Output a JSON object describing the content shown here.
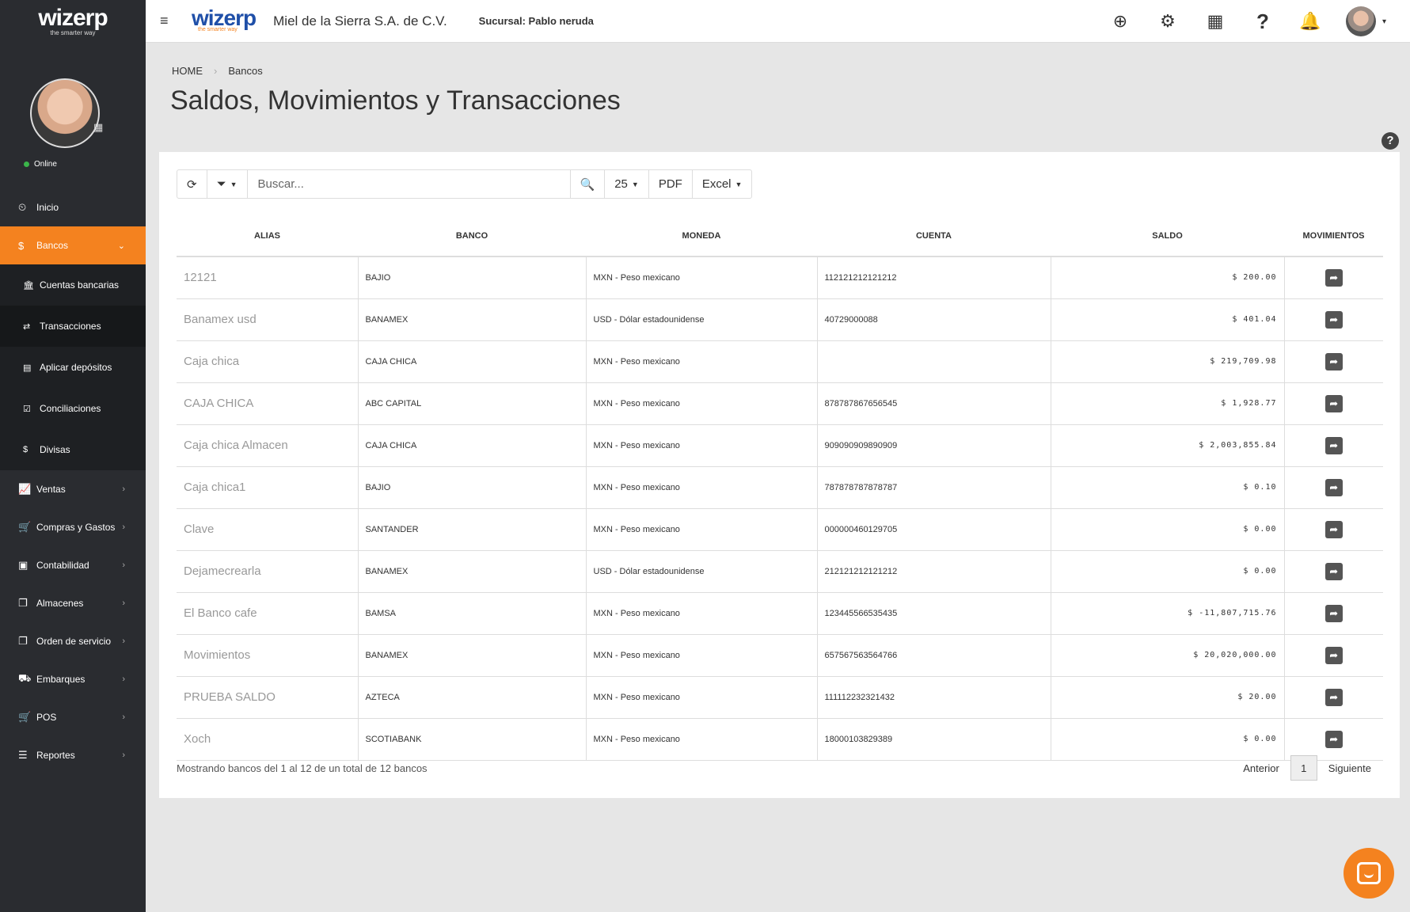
{
  "sidebar": {
    "brand": "wizerp",
    "tagline": "the smarter way",
    "calendar_icon": "calendar-icon",
    "status": "Online",
    "items": [
      {
        "icon": "dashboard-icon",
        "glyph": "⏲",
        "label": "Inicio"
      },
      {
        "icon": "dollar-icon",
        "glyph": "$",
        "label": "Bancos"
      }
    ],
    "submenu": [
      {
        "icon": "bank-icon",
        "glyph": "🏛",
        "label": "Cuentas bancarias"
      },
      {
        "icon": "exchange-icon",
        "glyph": "⇄",
        "label": "Transacciones"
      },
      {
        "icon": "file-icon",
        "glyph": "▤",
        "label": "Aplicar depósitos"
      },
      {
        "icon": "check-square-icon",
        "glyph": "☑",
        "label": "Conciliaciones"
      },
      {
        "icon": "dollar-icon",
        "glyph": "$",
        "label": "Divisas"
      }
    ],
    "menu": [
      {
        "icon": "chart-line-icon",
        "glyph": "📈",
        "label": "Ventas"
      },
      {
        "icon": "cart-icon",
        "glyph": "🛒",
        "label": "Compras y Gastos"
      },
      {
        "icon": "money-icon",
        "glyph": "▣",
        "label": "Contabilidad"
      },
      {
        "icon": "files-icon",
        "glyph": "❐",
        "label": "Almacenes"
      },
      {
        "icon": "files-icon",
        "glyph": "❐",
        "label": "Orden de servicio"
      },
      {
        "icon": "truck-icon",
        "glyph": "⛟",
        "label": "Embarques"
      },
      {
        "icon": "cart-icon",
        "glyph": "🛒",
        "label": "POS"
      },
      {
        "icon": "list-icon",
        "glyph": "☰",
        "label": "Reportes"
      }
    ]
  },
  "topbar": {
    "brand": "wizerp",
    "tagline": "the smarter way",
    "company": "Miel de la Sierra S.A. de C.V.",
    "sucursal_label": "Sucursal:",
    "sucursal_value": "Pablo neruda",
    "icons": [
      "plus-circle-icon",
      "gears-icon",
      "calendar-icon",
      "question-icon",
      "bell-icon"
    ]
  },
  "breadcrumb": [
    "HOME",
    "Bancos"
  ],
  "title": "Saldos, Movimientos y Transacciones",
  "toolbar": {
    "search_placeholder": "Buscar...",
    "page_size": "25",
    "pdf": "PDF",
    "excel": "Excel"
  },
  "table": {
    "columns": [
      "ALIAS",
      "BANCO",
      "MONEDA",
      "CUENTA",
      "SALDO",
      "MOVIMIENTOS"
    ],
    "rows": [
      [
        "12121",
        "BAJIO",
        "MXN - Peso mexicano",
        "112121212121212",
        "$ 200.00"
      ],
      [
        "Banamex usd",
        "BANAMEX",
        "USD - Dólar estadounidense",
        "40729000088",
        "$ 401.04"
      ],
      [
        "Caja chica",
        "CAJA CHICA",
        "MXN - Peso mexicano",
        "",
        "$ 219,709.98"
      ],
      [
        "CAJA CHICA",
        "ABC CAPITAL",
        "MXN - Peso mexicano",
        "878787867656545",
        "$ 1,928.77"
      ],
      [
        "Caja chica Almacen",
        "CAJA CHICA",
        "MXN - Peso mexicano",
        "909090909890909",
        "$ 2,003,855.84"
      ],
      [
        "Caja chica1",
        "BAJIO",
        "MXN - Peso mexicano",
        "787878787878787",
        "$ 0.10"
      ],
      [
        "Clave",
        "SANTANDER",
        "MXN - Peso mexicano",
        "000000460129705",
        "$ 0.00"
      ],
      [
        "Dejamecrearla",
        "BANAMEX",
        "USD - Dólar estadounidense",
        "212121212121212",
        "$ 0.00"
      ],
      [
        "El Banco cafe",
        "BAMSA",
        "MXN - Peso mexicano",
        "123445566535435",
        "$ -11,807,715.76"
      ],
      [
        "Movimientos",
        "BANAMEX",
        "MXN - Peso mexicano",
        "657567563564766",
        "$ 20,020,000.00"
      ],
      [
        "PRUEBA SALDO",
        "AZTECA",
        "MXN - Peso mexicano",
        "111112232321432",
        "$ 20.00"
      ],
      [
        "Xoch",
        "SCOTIABANK",
        "MXN - Peso mexicano",
        "18000103829389",
        "$ 0.00"
      ]
    ]
  },
  "footer": {
    "info": "Mostrando bancos del 1 al 12 de un total de 12 bancos",
    "prev": "Anterior",
    "page": "1",
    "next": "Siguiente"
  },
  "colors": {
    "accent": "#f4821f",
    "sidebar": "#2a2c30",
    "brand_blue": "#1f4fa8"
  }
}
